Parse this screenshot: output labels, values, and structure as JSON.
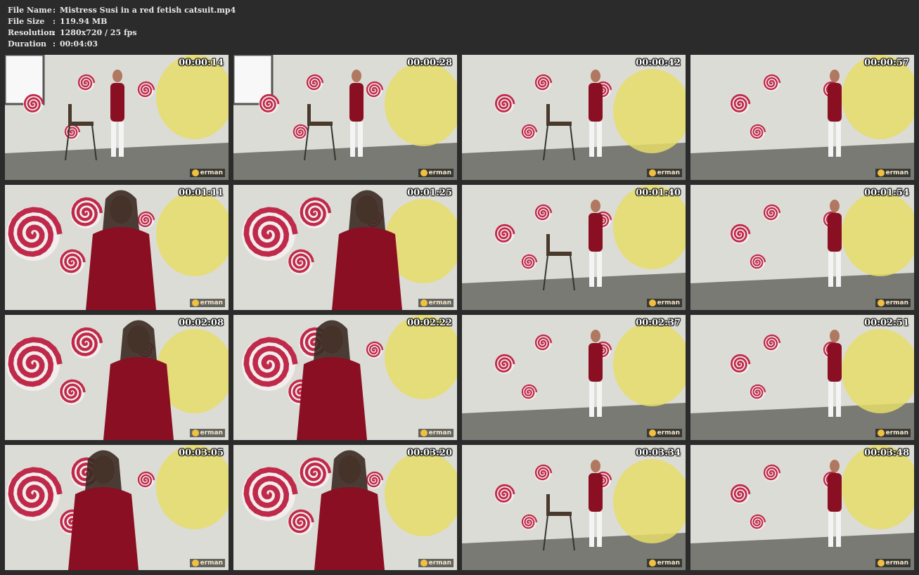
{
  "info": [
    {
      "key": "File Name",
      "value": "Mistress Susi in a red fetish catsuit.mp4"
    },
    {
      "key": "File Size",
      "value": "119.94 MB"
    },
    {
      "key": "Resolution",
      "value": "1280x720 / 25 fps"
    },
    {
      "key": "Duration",
      "value": "00:04:03"
    }
  ],
  "separator": ":",
  "logo_text": "erman",
  "colors": {
    "background": "#2b2b2b",
    "wall": "#dcdcd6",
    "floor": "#7a7a74",
    "catsuit": "#8a0f22",
    "spiral": "#c02a4a",
    "mural_yellow": "#e6dc6a",
    "boots": "#f4f4f4"
  },
  "thumbnails": [
    {
      "time": "00:00:14",
      "scene": "room"
    },
    {
      "time": "00:00:28",
      "scene": "room"
    },
    {
      "time": "00:00:42",
      "scene": "seated"
    },
    {
      "time": "00:00:57",
      "scene": "standing"
    },
    {
      "time": "00:01:11",
      "scene": "closeup"
    },
    {
      "time": "00:01:25",
      "scene": "closeup"
    },
    {
      "time": "00:01:40",
      "scene": "chair"
    },
    {
      "time": "00:01:54",
      "scene": "standing"
    },
    {
      "time": "00:02:08",
      "scene": "closeup"
    },
    {
      "time": "00:02:22",
      "scene": "closeup"
    },
    {
      "time": "00:02:37",
      "scene": "standing"
    },
    {
      "time": "00:02:51",
      "scene": "kick"
    },
    {
      "time": "00:03:05",
      "scene": "closeup"
    },
    {
      "time": "00:03:20",
      "scene": "closeup"
    },
    {
      "time": "00:03:34",
      "scene": "seated"
    },
    {
      "time": "00:03:48",
      "scene": "standing"
    }
  ]
}
